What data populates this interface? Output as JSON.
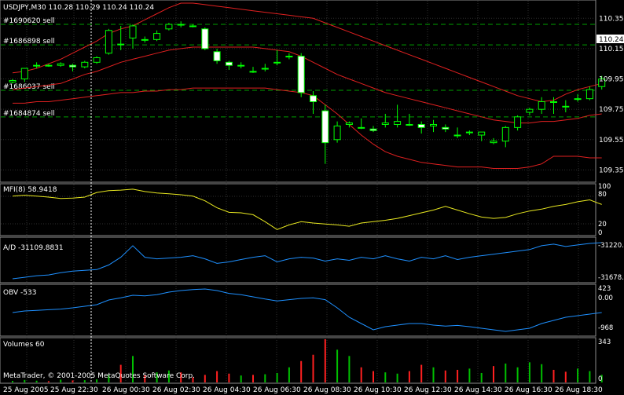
{
  "window": {
    "symbol": "USDJPY,M30"
  },
  "price_panel": {
    "header": "USDJPY,M30  110.28 110.29 110.24 110.24",
    "current_price": "110.24",
    "order_labels": [
      "#1690620 sell",
      "#1686898 sell",
      "#1686037 sell",
      "#1684874 sell"
    ],
    "order_levels": [
      110.31,
      110.175,
      109.875,
      109.7
    ],
    "y_ticks": [
      "110.35",
      "110.15",
      "109.95",
      "109.75",
      "109.55",
      "109.35"
    ],
    "y_tick_values": [
      110.35,
      110.15,
      109.95,
      109.75,
      109.55,
      109.35
    ]
  },
  "mfi_panel": {
    "label": "MFI(8) 58.9418",
    "scale_labels": [
      "100",
      "80",
      "20",
      "0"
    ]
  },
  "ad_panel": {
    "label": "A/D -31109.8831",
    "scale_labels": [
      "-31220.",
      "-31678."
    ]
  },
  "obv_panel": {
    "label": "OBV -533",
    "scale_labels": [
      "423",
      "0.00",
      "-968"
    ]
  },
  "volume_panel": {
    "label": "Volumes 60",
    "scale_labels": [
      "343",
      "0"
    ],
    "watermark": "MetaTrader, © 2001-2005 MetaQuotes Software Corp."
  },
  "time_axis": [
    "25 Aug 2005",
    "25 Aug 22:30",
    "26 Aug 00:30",
    "26 Aug 02:30",
    "26 Aug 04:30",
    "26 Aug 06:30",
    "26 Aug 08:30",
    "26 Aug 10:30",
    "26 Aug 12:30",
    "26 Aug 14:30",
    "26 Aug 16:30",
    "26 Aug 18:30"
  ],
  "colors": {
    "bull": "#00ff00",
    "bear": "#00ff00",
    "grid": "#2f2f2f",
    "order_line": "#00a000",
    "bollinger": "#e02020",
    "mfi": "#e8e820",
    "ad": "#1e90ff",
    "obv": "#1e90ff",
    "vol_up": "#00c000",
    "vol_down": "#ff2020"
  },
  "chart_data": {
    "type": "candlestick",
    "title": "USDJPY,M30",
    "ylim": [
      109.29,
      110.45
    ],
    "ohlc": [
      [
        109.93,
        109.95,
        109.92,
        109.94
      ],
      [
        109.95,
        110.02,
        109.93,
        110.02
      ],
      [
        110.04,
        110.06,
        110.02,
        110.04
      ],
      [
        110.04,
        110.05,
        110.03,
        110.04
      ],
      [
        110.04,
        110.06,
        110.03,
        110.05
      ],
      [
        110.04,
        110.05,
        110.0,
        110.03
      ],
      [
        110.03,
        110.07,
        110.02,
        110.06
      ],
      [
        110.06,
        110.1,
        110.05,
        110.09
      ],
      [
        110.12,
        110.28,
        110.11,
        110.27
      ],
      [
        110.18,
        110.3,
        110.14,
        110.18
      ],
      [
        110.22,
        110.31,
        110.15,
        110.3
      ],
      [
        110.21,
        110.23,
        110.19,
        110.21
      ],
      [
        110.21,
        110.27,
        110.2,
        110.25
      ],
      [
        110.28,
        110.32,
        110.27,
        110.31
      ],
      [
        110.31,
        110.33,
        110.29,
        110.31
      ],
      [
        110.3,
        110.31,
        110.29,
        110.3
      ],
      [
        110.28,
        110.29,
        110.14,
        110.15
      ],
      [
        110.13,
        110.15,
        110.05,
        110.07
      ],
      [
        110.06,
        110.07,
        110.01,
        110.04
      ],
      [
        110.04,
        110.06,
        110.02,
        110.04
      ],
      [
        110.0,
        110.03,
        109.99,
        110.0
      ],
      [
        110.02,
        110.05,
        110.0,
        110.02
      ],
      [
        110.06,
        110.14,
        110.04,
        110.06
      ],
      [
        110.1,
        110.12,
        110.08,
        110.1
      ],
      [
        110.1,
        110.12,
        109.83,
        109.86
      ],
      [
        109.84,
        109.87,
        109.72,
        109.8
      ],
      [
        109.74,
        109.78,
        109.39,
        109.53
      ],
      [
        109.55,
        109.67,
        109.53,
        109.64
      ],
      [
        109.65,
        109.67,
        109.63,
        109.66
      ],
      [
        109.63,
        109.69,
        109.62,
        109.63
      ],
      [
        109.62,
        109.64,
        109.6,
        109.61
      ],
      [
        109.65,
        109.72,
        109.63,
        109.66
      ],
      [
        109.65,
        109.78,
        109.63,
        109.67
      ],
      [
        109.65,
        109.72,
        109.64,
        109.65
      ],
      [
        109.65,
        109.67,
        109.59,
        109.63
      ],
      [
        109.64,
        109.68,
        109.6,
        109.65
      ],
      [
        109.63,
        109.65,
        109.6,
        109.62
      ],
      [
        109.58,
        109.63,
        109.56,
        109.58
      ],
      [
        109.6,
        109.61,
        109.58,
        109.6
      ],
      [
        109.58,
        109.6,
        109.54,
        109.6
      ],
      [
        109.53,
        109.56,
        109.52,
        109.54
      ],
      [
        109.54,
        109.64,
        109.5,
        109.63
      ],
      [
        109.63,
        109.71,
        109.61,
        109.7
      ],
      [
        109.73,
        109.76,
        109.71,
        109.75
      ],
      [
        109.75,
        109.83,
        109.72,
        109.8
      ],
      [
        109.8,
        109.83,
        109.72,
        109.8
      ],
      [
        109.77,
        109.81,
        109.73,
        109.77
      ],
      [
        109.82,
        109.85,
        109.8,
        109.82
      ],
      [
        109.82,
        109.9,
        109.81,
        109.88
      ],
      [
        109.9,
        109.97,
        109.88,
        109.95
      ]
    ],
    "bollinger_upper": [
      109.99,
      110.0,
      110.02,
      110.05,
      110.08,
      110.12,
      110.16,
      110.2,
      110.25,
      110.28,
      110.3,
      110.34,
      110.38,
      110.42,
      110.45,
      110.45,
      110.44,
      110.43,
      110.42,
      110.41,
      110.4,
      110.39,
      110.38,
      110.37,
      110.36,
      110.35,
      110.32,
      110.29,
      110.26,
      110.23,
      110.2,
      110.17,
      110.14,
      110.11,
      110.08,
      110.05,
      110.02,
      109.99,
      109.96,
      109.93,
      109.9,
      109.87,
      109.84,
      109.82,
      109.8,
      109.81,
      109.85,
      109.88,
      109.9,
      109.92
    ],
    "bollinger_middle": [
      109.88,
      109.89,
      109.9,
      109.91,
      109.92,
      109.95,
      109.98,
      110.0,
      110.03,
      110.06,
      110.08,
      110.1,
      110.12,
      110.14,
      110.15,
      110.16,
      110.16,
      110.16,
      110.16,
      110.16,
      110.16,
      110.15,
      110.14,
      110.13,
      110.1,
      110.06,
      110.02,
      109.98,
      109.95,
      109.92,
      109.89,
      109.86,
      109.84,
      109.82,
      109.8,
      109.78,
      109.76,
      109.74,
      109.72,
      109.7,
      109.68,
      109.67,
      109.66,
      109.66,
      109.67,
      109.67,
      109.68,
      109.69,
      109.71,
      109.72
    ],
    "bollinger_lower": [
      109.79,
      109.79,
      109.8,
      109.8,
      109.81,
      109.82,
      109.83,
      109.84,
      109.85,
      109.86,
      109.86,
      109.87,
      109.87,
      109.88,
      109.88,
      109.89,
      109.89,
      109.89,
      109.89,
      109.89,
      109.89,
      109.89,
      109.88,
      109.87,
      109.86,
      109.84,
      109.78,
      109.72,
      109.65,
      109.58,
      109.52,
      109.47,
      109.44,
      109.42,
      109.4,
      109.39,
      109.38,
      109.37,
      109.37,
      109.37,
      109.36,
      109.36,
      109.36,
      109.37,
      109.39,
      109.44,
      109.44,
      109.44,
      109.43,
      109.43
    ],
    "mfi": [
      80,
      82,
      80,
      78,
      75,
      76,
      78,
      88,
      92,
      93,
      95,
      90,
      87,
      85,
      83,
      80,
      70,
      55,
      45,
      44,
      40,
      25,
      8,
      18,
      25,
      22,
      20,
      18,
      15,
      22,
      25,
      28,
      32,
      38,
      44,
      50,
      58,
      50,
      42,
      35,
      32,
      34,
      42,
      48,
      52,
      58,
      62,
      68,
      72,
      62
    ],
    "ad": [
      -31680,
      -31660,
      -31640,
      -31630,
      -31600,
      -31580,
      -31570,
      -31560,
      -31500,
      -31400,
      -31250,
      -31400,
      -31420,
      -31410,
      -31400,
      -31380,
      -31420,
      -31480,
      -31460,
      -31430,
      -31400,
      -31380,
      -31460,
      -31420,
      -31400,
      -31410,
      -31450,
      -31420,
      -31440,
      -31400,
      -31420,
      -31380,
      -31420,
      -31450,
      -31400,
      -31420,
      -31380,
      -31430,
      -31400,
      -31380,
      -31360,
      -31340,
      -31320,
      -31300,
      -31250,
      -31230,
      -31260,
      -31240,
      -31220,
      -31210
    ],
    "obv": [
      -350,
      -300,
      -280,
      -260,
      -240,
      -200,
      -150,
      -100,
      50,
      120,
      200,
      180,
      220,
      300,
      350,
      380,
      400,
      350,
      260,
      220,
      150,
      80,
      20,
      60,
      100,
      120,
      60,
      -200,
      -500,
      -700,
      -900,
      -800,
      -750,
      -700,
      -700,
      -750,
      -780,
      -760,
      -800,
      -850,
      -900,
      -950,
      -900,
      -850,
      -700,
      -600,
      -500,
      -450,
      -400,
      -350
    ],
    "volume": [
      12,
      20,
      14,
      10,
      22,
      16,
      18,
      24,
      60,
      140,
      210,
      60,
      80,
      95,
      80,
      40,
      60,
      90,
      70,
      55,
      60,
      65,
      75,
      120,
      170,
      220,
      343,
      260,
      210,
      120,
      90,
      80,
      70,
      90,
      140,
      120,
      95,
      100,
      110,
      75,
      130,
      150,
      120,
      160,
      145,
      100,
      85,
      110,
      90,
      60
    ],
    "volume_up": [
      1,
      1,
      1,
      0,
      1,
      0,
      1,
      1,
      1,
      0,
      1,
      0,
      1,
      1,
      0,
      0,
      0,
      0,
      0,
      1,
      0,
      1,
      1,
      1,
      0,
      0,
      0,
      1,
      1,
      0,
      0,
      1,
      1,
      0,
      0,
      1,
      0,
      0,
      1,
      1,
      0,
      1,
      1,
      1,
      1,
      0,
      0,
      1,
      1,
      1
    ]
  }
}
